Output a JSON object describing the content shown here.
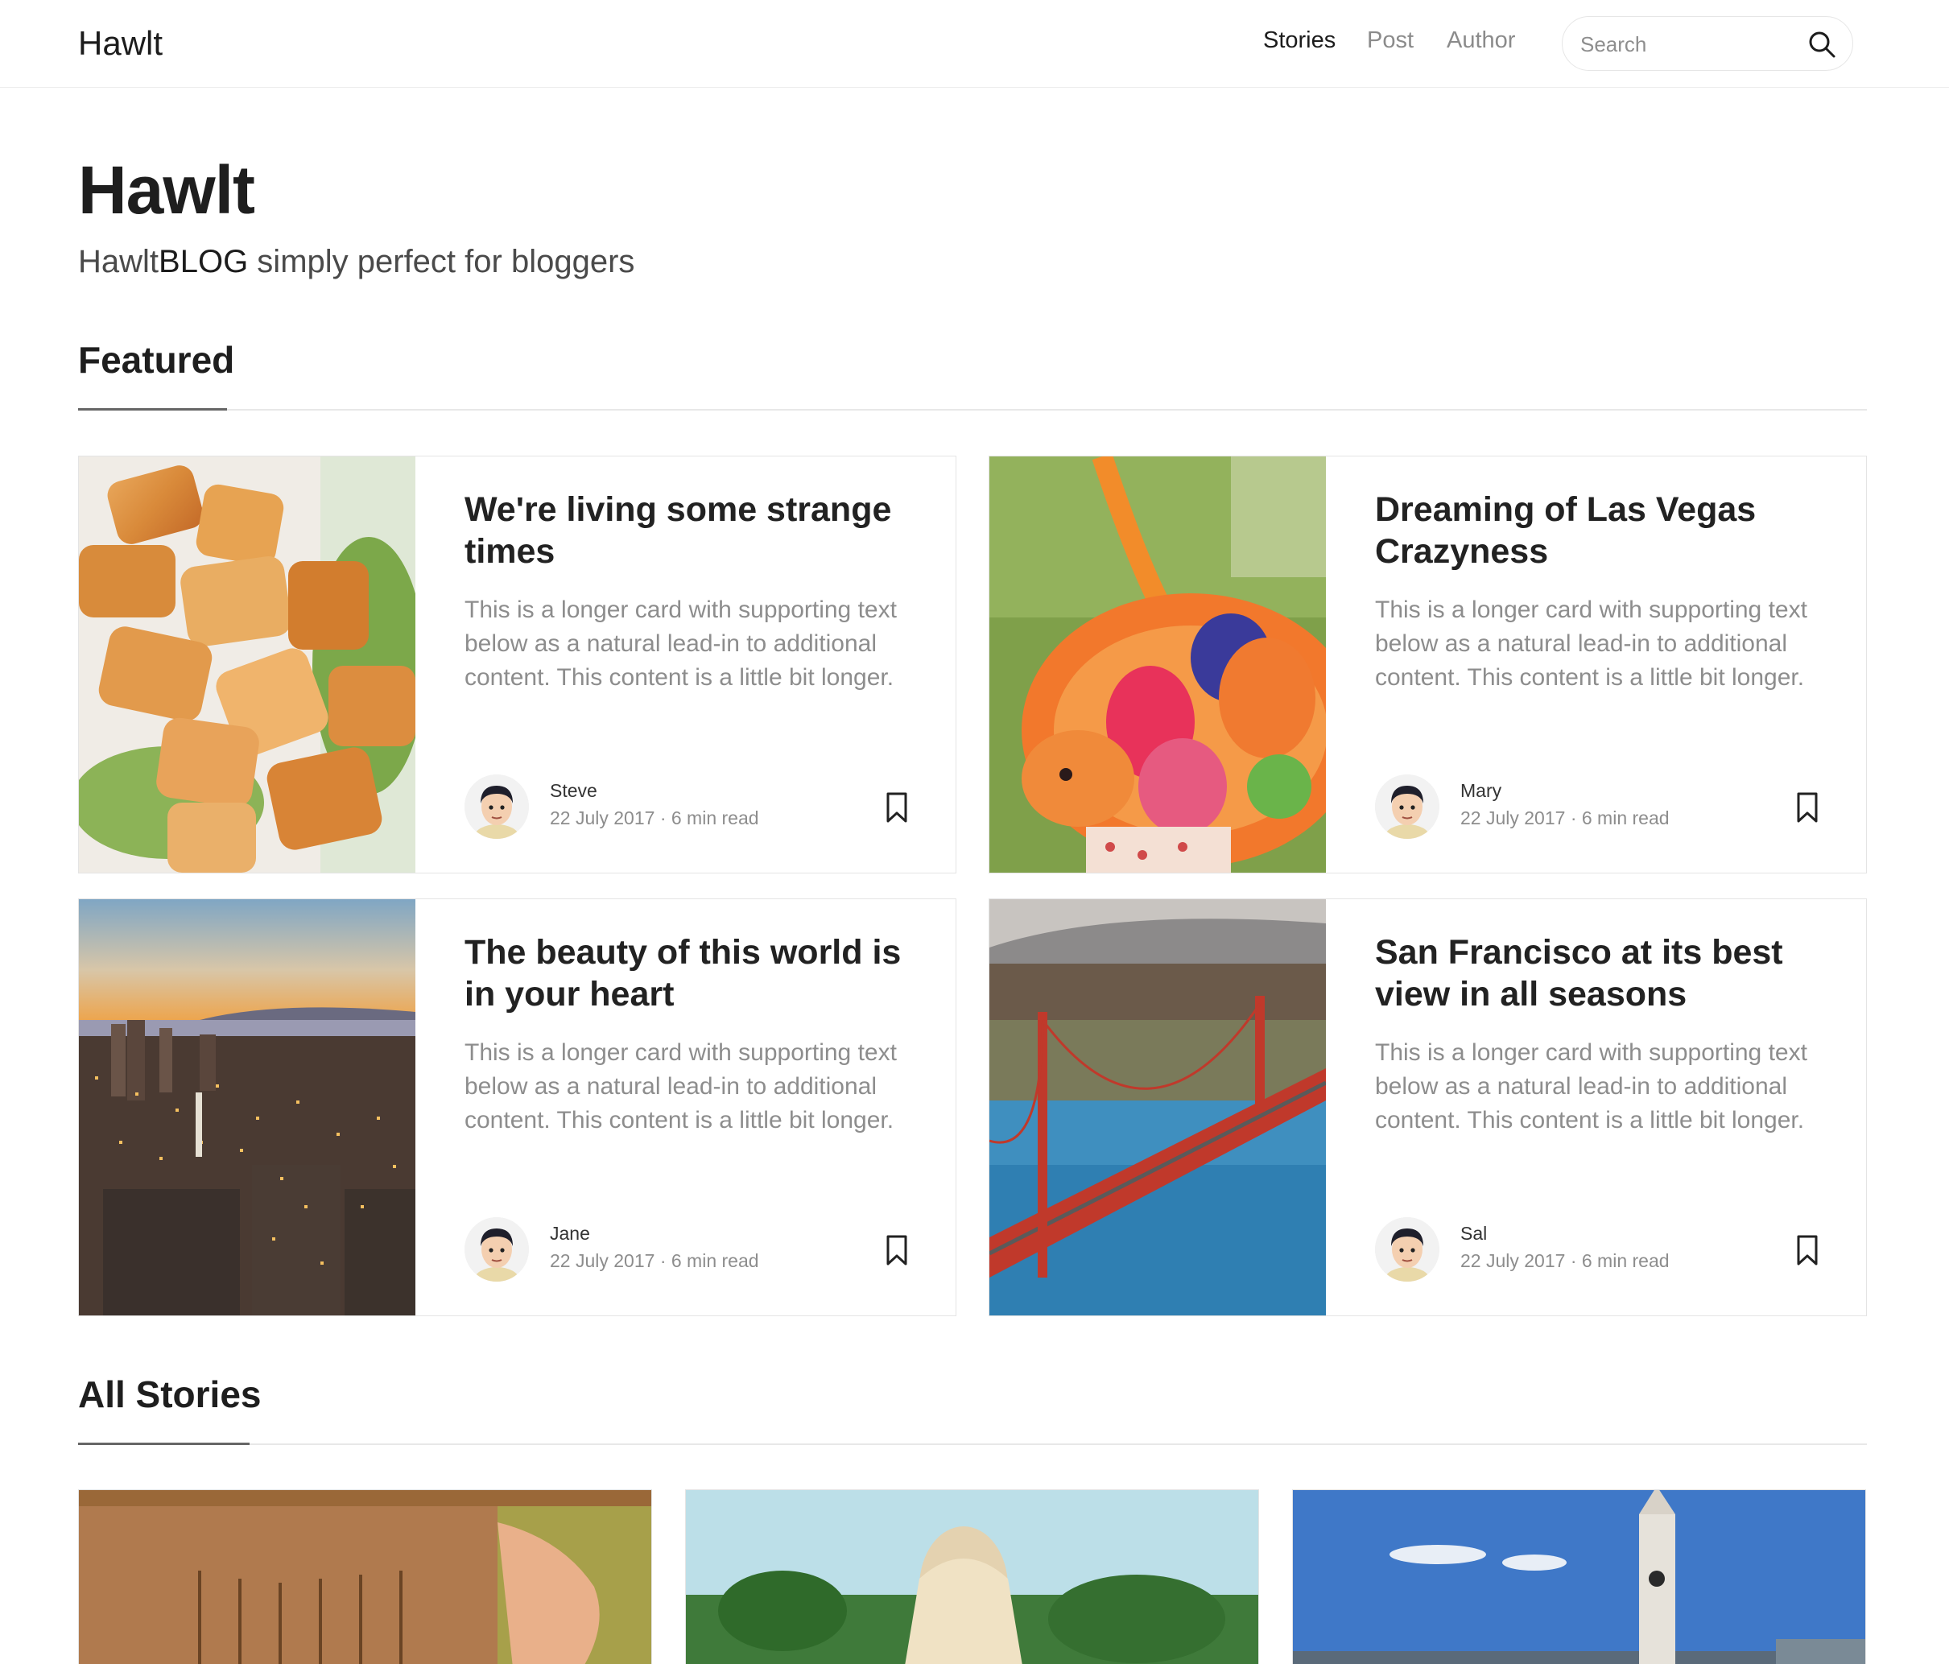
{
  "nav": {
    "brand": "Hawlt",
    "links": [
      "Stories",
      "Post",
      "Author"
    ],
    "search_placeholder": "Search"
  },
  "hero": {
    "title": "Hawlt",
    "subtitle_start": "Hawlt",
    "subtitle_bold": "BLOG",
    "subtitle_end": " simply perfect for bloggers"
  },
  "featured": {
    "heading": "Featured",
    "cards": [
      {
        "title": "We're living some strange times",
        "text": "This is a longer card with supporting text below as a natural lead-in to additional content. This content is a little bit longer.",
        "author": "Steve",
        "meta": "22 July 2017 · 6 min read",
        "image": "food-salad-photo"
      },
      {
        "title": "Dreaming of Las Vegas Crazyness",
        "text": "This is a longer card with supporting text below as a natural lead-in to additional content. This content is a little bit longer.",
        "author": "Mary",
        "meta": "22 July 2017 · 6 min read",
        "image": "easter-eggs-photo"
      },
      {
        "title": "The beauty of this world is in your heart",
        "text": "This is a longer card with supporting text below as a natural lead-in to additional content. This content is a little bit longer.",
        "author": "Jane",
        "meta": "22 July 2017 · 6 min read",
        "image": "city-sunset-photo"
      },
      {
        "title": "San Francisco at its best view in all seasons",
        "text": "This is a longer card with supporting text below as a natural lead-in to additional content. This content is a little bit longer.",
        "author": "Sal",
        "meta": "22 July 2017 · 6 min read",
        "image": "golden-gate-bridge-photo"
      }
    ]
  },
  "stories": {
    "heading": "All Stories",
    "cards": [
      {
        "image": "fringe-outfit-photo"
      },
      {
        "image": "woman-nature-photo"
      },
      {
        "image": "clock-tower-photo"
      }
    ]
  }
}
